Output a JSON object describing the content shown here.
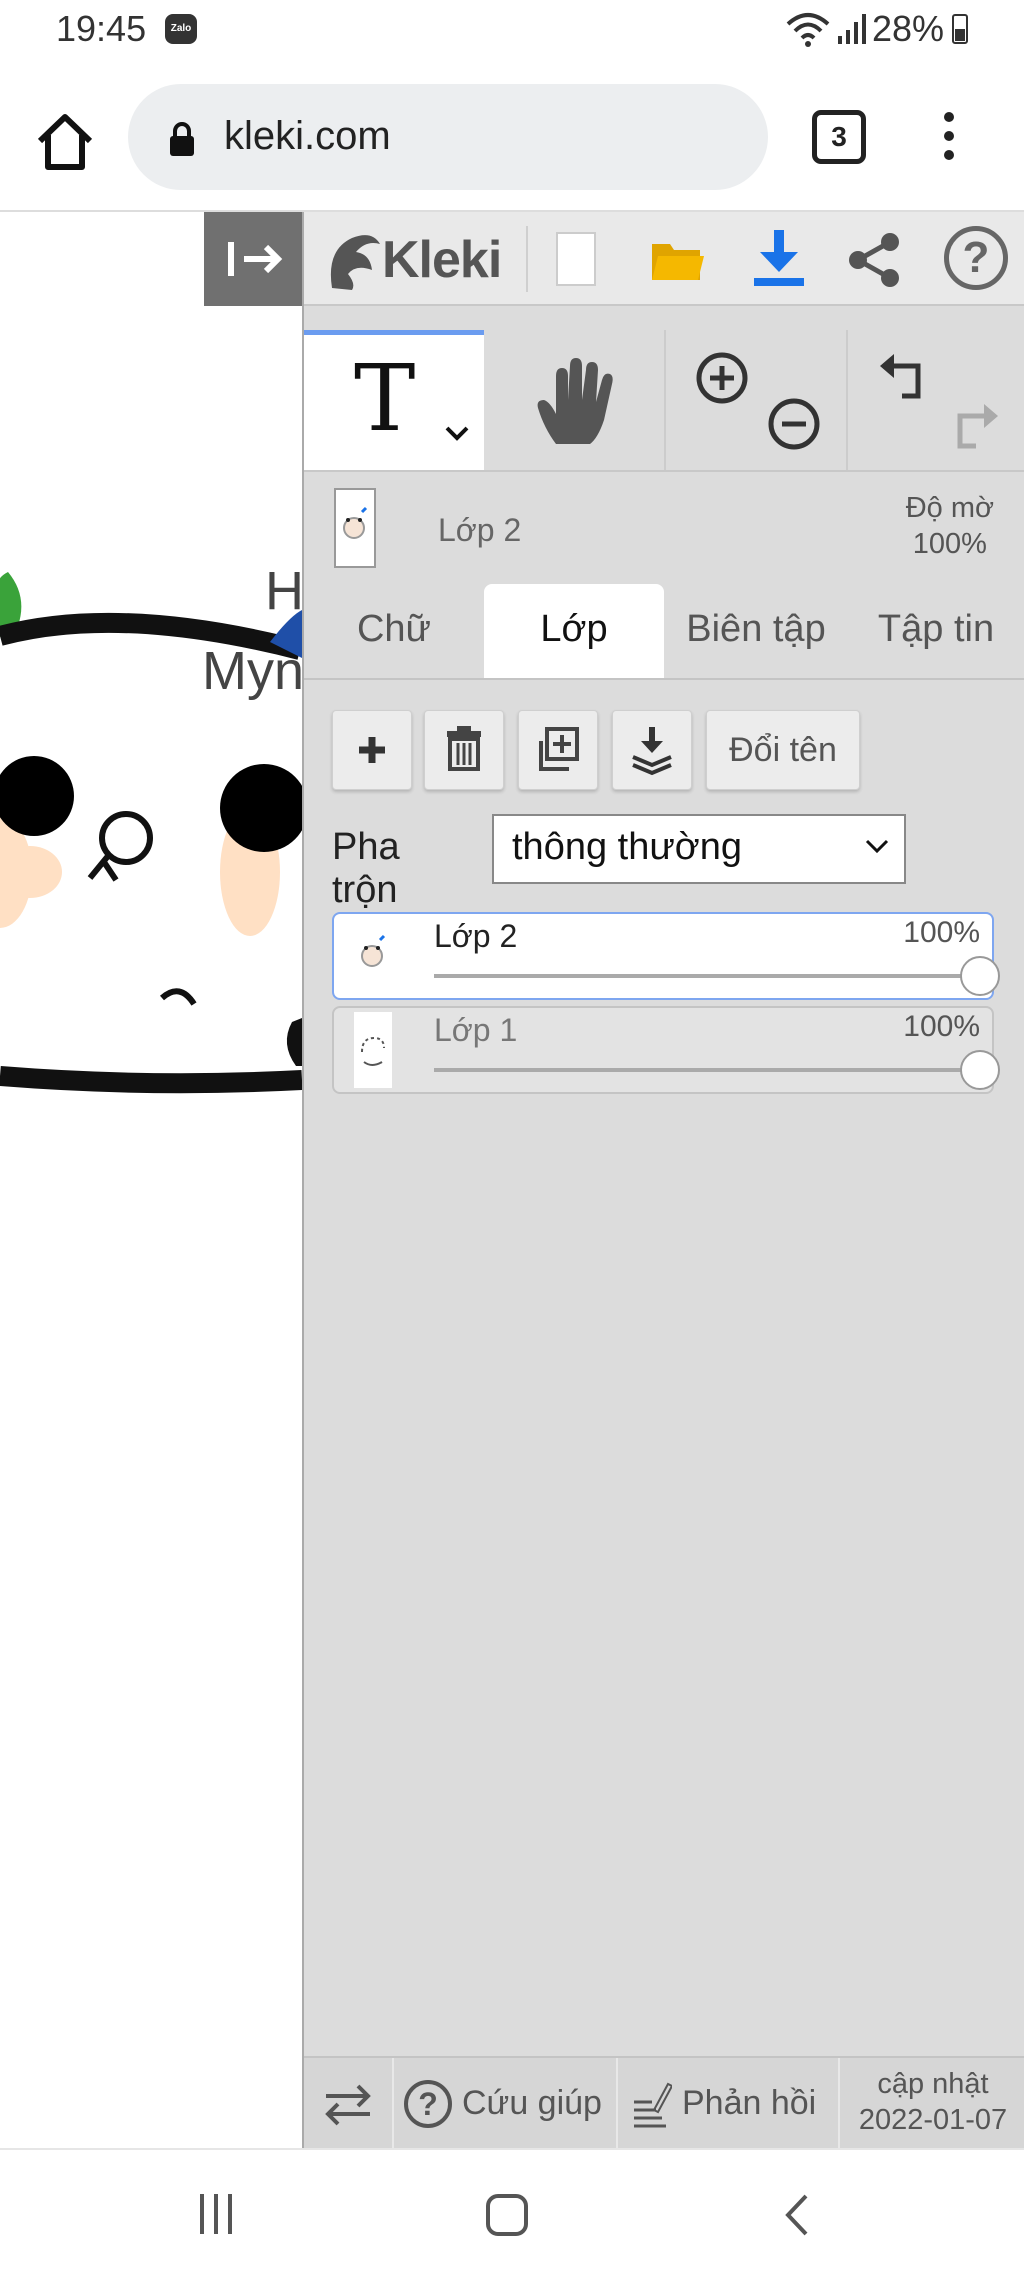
{
  "status_bar": {
    "time": "19:45",
    "app_icon": "Zalo",
    "battery": "28%"
  },
  "browser": {
    "url": "kleki.com",
    "tab_count": "3"
  },
  "canvas": {
    "text_fragment_1": "H",
    "text_fragment_2": "Myn"
  },
  "toolbar": {
    "logo": "Kleki"
  },
  "tools": {
    "text_tool_glyph": "T"
  },
  "layer_header": {
    "current_layer": "Lớp 2",
    "opacity_label": "Độ mờ",
    "opacity_value": "100%"
  },
  "tabs": [
    {
      "label": "Chữ"
    },
    {
      "label": "Lớp"
    },
    {
      "label": "Biên tập"
    },
    {
      "label": "Tập tin"
    }
  ],
  "layer_actions": {
    "rename_label": "Đổi tên"
  },
  "blend": {
    "label": "Pha trộn",
    "value": "thông thường"
  },
  "layers": [
    {
      "name": "Lớp 2",
      "opacity": "100%",
      "opacity_value": 1.0
    },
    {
      "name": "Lớp 1",
      "opacity": "100%",
      "opacity_value": 1.0
    }
  ],
  "bottom_bar": {
    "help_label": "Cứu giúp",
    "feedback_label": "Phản hồi",
    "update_label": "cập nhật",
    "update_date": "2022-01-07"
  },
  "colors": {
    "accent": "#6b9cf0",
    "download": "#1a73e8",
    "folder": "#f5b800"
  }
}
